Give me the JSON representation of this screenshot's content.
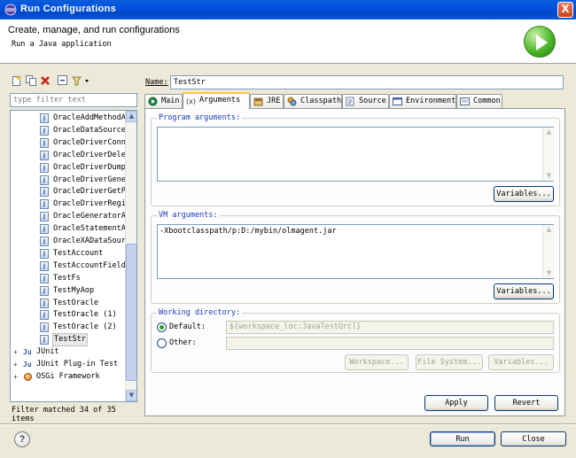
{
  "window": {
    "title": "Run Configurations",
    "close_glyph": "X"
  },
  "header": {
    "title": "Create, manage, and run configurations",
    "subtitle": "Run a Java application"
  },
  "left": {
    "filter_placeholder": "type filter text",
    "tree_items": [
      {
        "label": "OracleAddMethodA",
        "type": "java"
      },
      {
        "label": "OracleDataSource",
        "type": "java"
      },
      {
        "label": "OracleDriverConn",
        "type": "java"
      },
      {
        "label": "OracleDriverDele",
        "type": "java"
      },
      {
        "label": "OracleDriverDump",
        "type": "java"
      },
      {
        "label": "OracleDriverGene",
        "type": "java"
      },
      {
        "label": "OracleDriverGetP",
        "type": "java"
      },
      {
        "label": "OracleDriverRegi",
        "type": "java"
      },
      {
        "label": "OracleGeneratorA",
        "type": "java"
      },
      {
        "label": "OracleStatementA",
        "type": "java"
      },
      {
        "label": "OracleXADataSour",
        "type": "java"
      },
      {
        "label": "TestAccount",
        "type": "java"
      },
      {
        "label": "TestAccountField",
        "type": "java"
      },
      {
        "label": "TestFs",
        "type": "java"
      },
      {
        "label": "TestMyAop",
        "type": "java"
      },
      {
        "label": "TestOracle",
        "type": "java"
      },
      {
        "label": "TestOracle (1)",
        "type": "java"
      },
      {
        "label": "TestOracle (2)",
        "type": "java"
      },
      {
        "label": "TestStr",
        "type": "java",
        "selected": true
      },
      {
        "label": "JUnit",
        "type": "junit",
        "level": 0
      },
      {
        "label": "JUnit Plug-in Test",
        "type": "junit",
        "level": 0
      },
      {
        "label": "OSGi Framework",
        "type": "osgi",
        "level": 0
      }
    ],
    "filter_status": "Filter matched 34 of 35 items"
  },
  "config": {
    "name_label": "Name:",
    "name_value": "TestStr",
    "tabs": [
      {
        "label": "Main",
        "icon": "main-tab-icon"
      },
      {
        "label": "Arguments",
        "icon": "arguments-tab-icon",
        "active": true
      },
      {
        "label": "JRE",
        "icon": "jre-tab-icon"
      },
      {
        "label": "Classpath",
        "icon": "classpath-tab-icon"
      },
      {
        "label": "Source",
        "icon": "source-tab-icon"
      },
      {
        "label": "Environment",
        "icon": "environment-tab-icon"
      },
      {
        "label": "Common",
        "icon": "common-tab-icon"
      }
    ],
    "program_args": {
      "label": "Program arguments:",
      "value": "",
      "variables_label": "Variables..."
    },
    "vm_args": {
      "label": "VM arguments:",
      "value": "-Xbootclasspath/p:D:/mybin/olmagent.jar",
      "variables_label": "Variables..."
    },
    "working_dir": {
      "label": "Working directory:",
      "default_label": "Default:",
      "default_value": "${workspace_loc:JavaTestOrcl}",
      "other_label": "Other:",
      "other_value": "",
      "workspace_label": "Workspace...",
      "filesystem_label": "File System...",
      "variables_label": "Variables..."
    },
    "apply_label": "Apply",
    "revert_label": "Revert"
  },
  "footer": {
    "help_glyph": "?",
    "run_label": "Run",
    "close_label": "Close"
  },
  "colors": {
    "accent": "#0050e0",
    "group_label": "#1a3cb8",
    "tab_highlight": "#ffc83c"
  }
}
